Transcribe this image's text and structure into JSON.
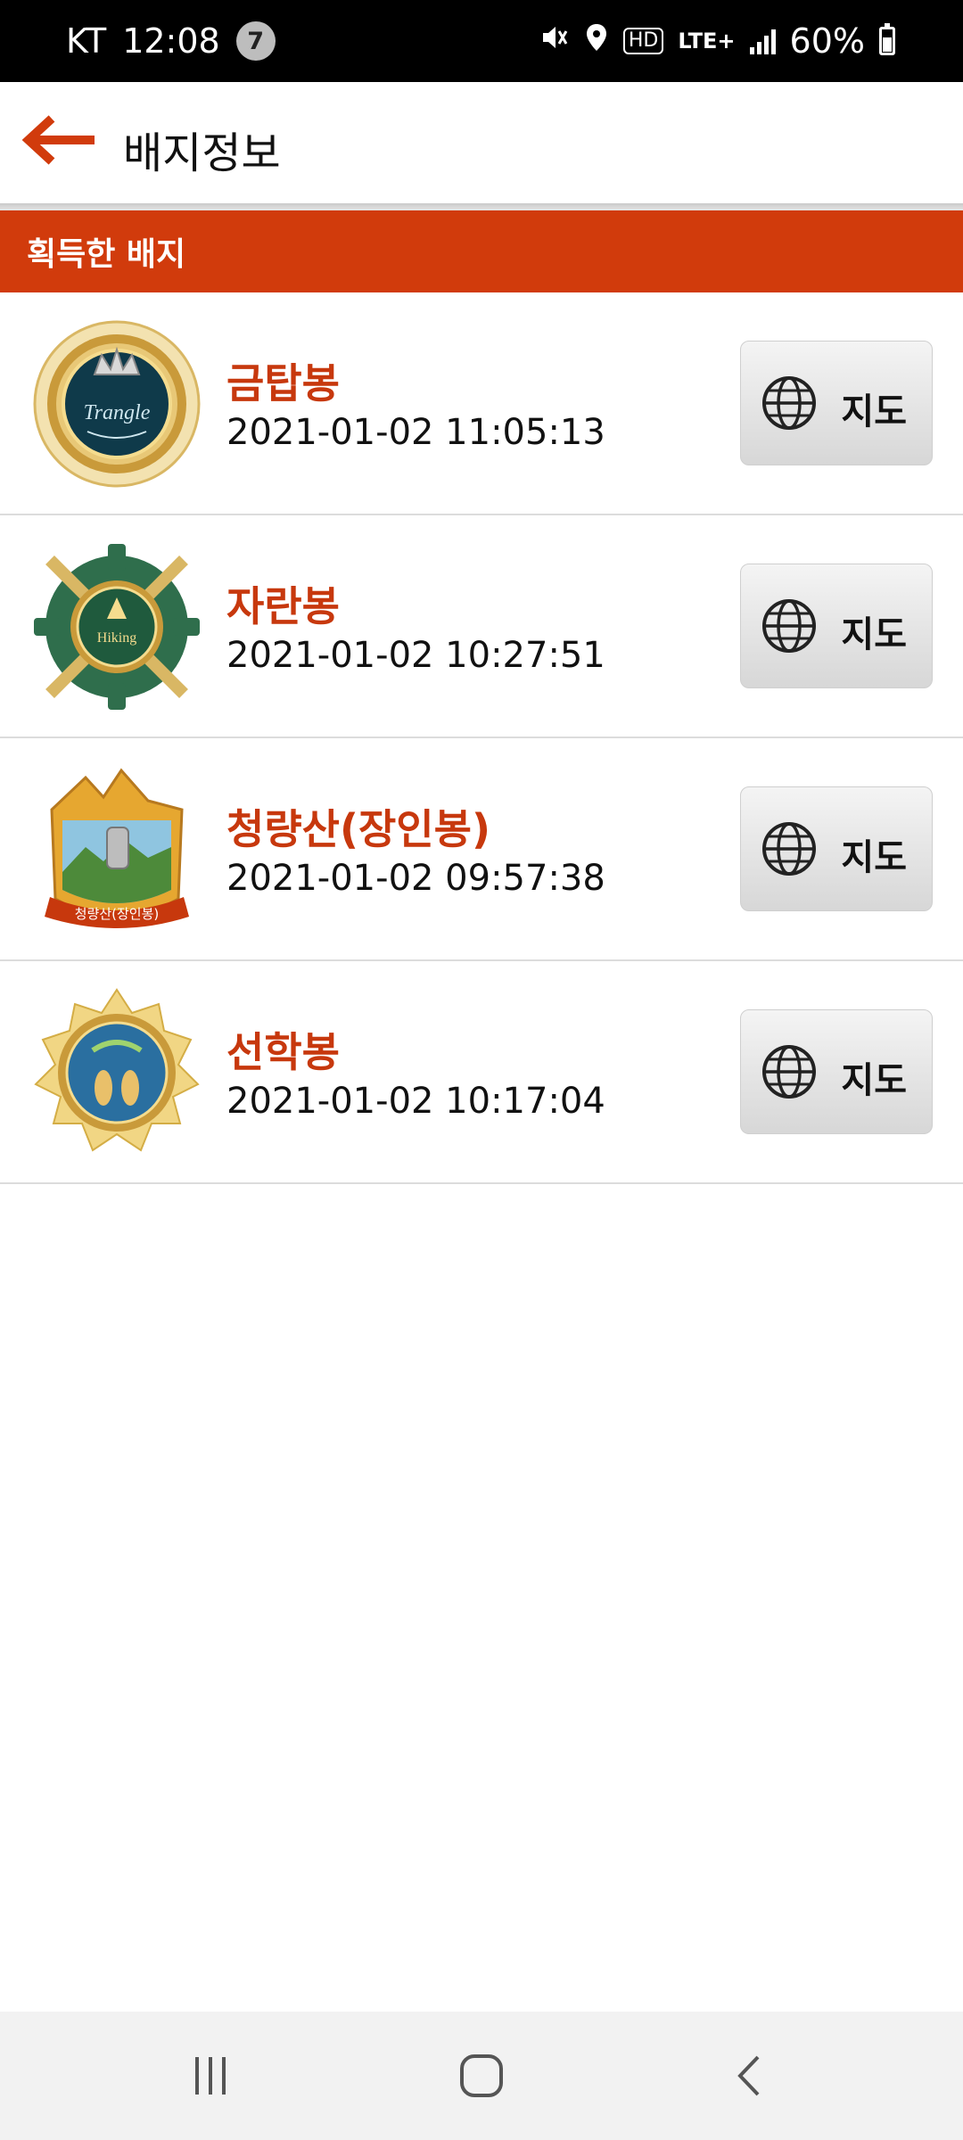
{
  "status_bar": {
    "carrier": "KT",
    "time": "12:08",
    "notification_count": "7",
    "hd_label": "HD",
    "network": "LTE+",
    "battery": "60%"
  },
  "header": {
    "title": "배지정보"
  },
  "section": {
    "title": "획득한 배지"
  },
  "badges": [
    {
      "name": "금탑봉",
      "acquired_at": "2021-01-02 11:05:13",
      "map_label": "지도",
      "icon": "crown-badge-icon"
    },
    {
      "name": "자란봉",
      "acquired_at": "2021-01-02 10:27:51",
      "map_label": "지도",
      "icon": "hiking-gear-badge-icon"
    },
    {
      "name": "청량산(장인봉)",
      "acquired_at": "2021-01-02 09:57:38",
      "map_label": "지도",
      "icon": "mountain-badge-icon"
    },
    {
      "name": "선학봉",
      "acquired_at": "2021-01-02 10:17:04",
      "map_label": "지도",
      "icon": "footprint-badge-icon"
    }
  ],
  "badge_texts": {
    "trangle": "Trangle",
    "hiking": "Hiking",
    "ribbon": "청량산(장인봉)"
  },
  "colors": {
    "accent": "#d13b0c",
    "badge_name": "#c7380d"
  }
}
